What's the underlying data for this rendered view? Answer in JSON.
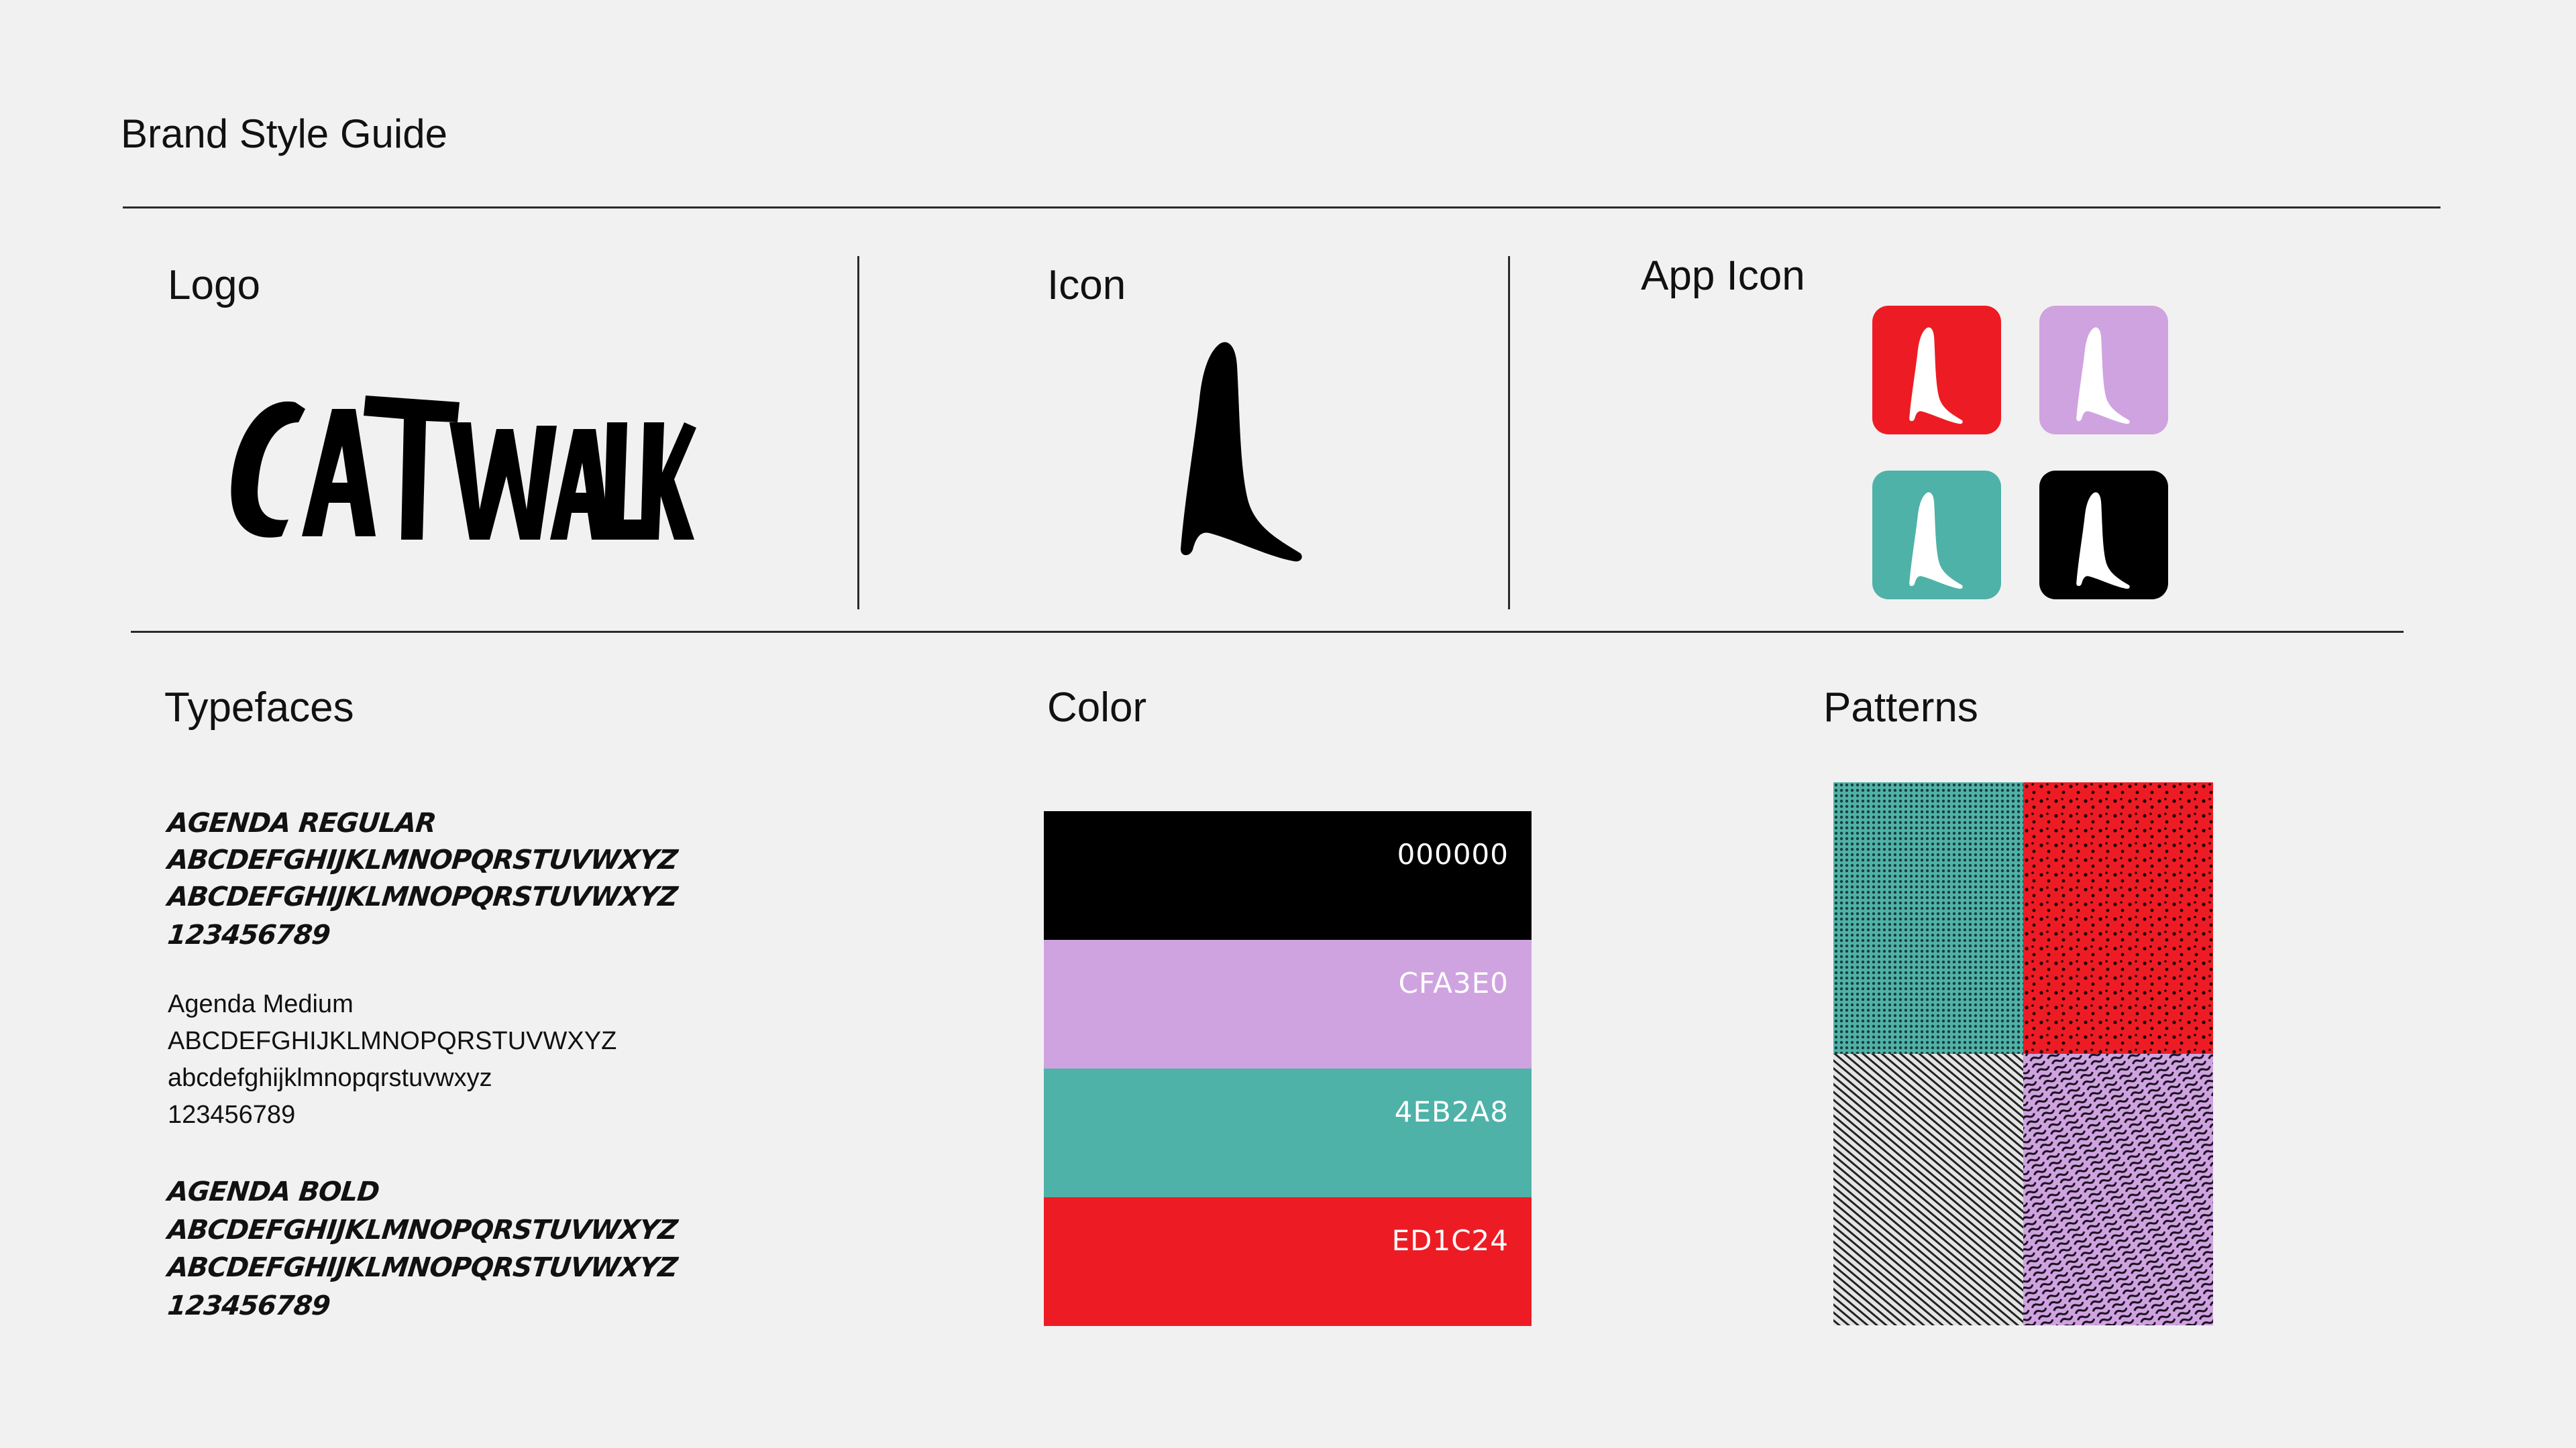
{
  "page": {
    "title": "Brand Style Guide"
  },
  "sections": {
    "logo": {
      "title": "Logo"
    },
    "icon": {
      "title": "Icon"
    },
    "app_icon": {
      "title": "App Icon"
    },
    "typefaces": {
      "title": "Typefaces"
    },
    "color": {
      "title": "Color"
    },
    "patterns": {
      "title": "Patterns"
    }
  },
  "brand": {
    "logo_text": "CATWALK",
    "icon_name": "high-heel-boot-icon"
  },
  "app_icons": [
    {
      "color": "#ED1C24",
      "name": "app-icon-red"
    },
    {
      "color": "#CFA3E0",
      "name": "app-icon-lavender"
    },
    {
      "color": "#4EB2A8",
      "name": "app-icon-teal"
    },
    {
      "color": "#000000",
      "name": "app-icon-black"
    }
  ],
  "typefaces": {
    "regular": {
      "name": "AGENDA REGULAR",
      "upper": "ABCDEFGHIJKLMNOPQRSTUVWXYZ",
      "lower": "ABCDEFGHIJKLMNOPQRSTUVWXYZ",
      "digits": "123456789"
    },
    "medium": {
      "name": "Agenda Medium",
      "upper": "ABCDEFGHIJKLMNOPQRSTUVWXYZ",
      "lower": "abcdefghijklmnopqrstuvwxyz",
      "digits": "123456789"
    },
    "bold": {
      "name": "AGENDA BOLD",
      "upper": "ABCDEFGHIJKLMNOPQRSTUVWXYZ",
      "lower": "ABCDEFGHIJKLMNOPQRSTUVWXYZ",
      "digits": "123456789"
    }
  },
  "colors": [
    {
      "hex": "000000",
      "value": "#000000"
    },
    {
      "hex": "CFA3E0",
      "value": "#CFA3E0"
    },
    {
      "hex": "4EB2A8",
      "value": "#4EB2A8"
    },
    {
      "hex": "ED1C24",
      "value": "#ED1C24"
    }
  ],
  "patterns": [
    {
      "name": "teal-halftone-pattern",
      "color": "#4EB2A8"
    },
    {
      "name": "red-dot-pattern",
      "color": "#ED1C24"
    },
    {
      "name": "gray-diagonal-line-pattern",
      "color": "#d9d9d9"
    },
    {
      "name": "lavender-squiggle-pattern",
      "color": "#CFA3E0"
    }
  ]
}
